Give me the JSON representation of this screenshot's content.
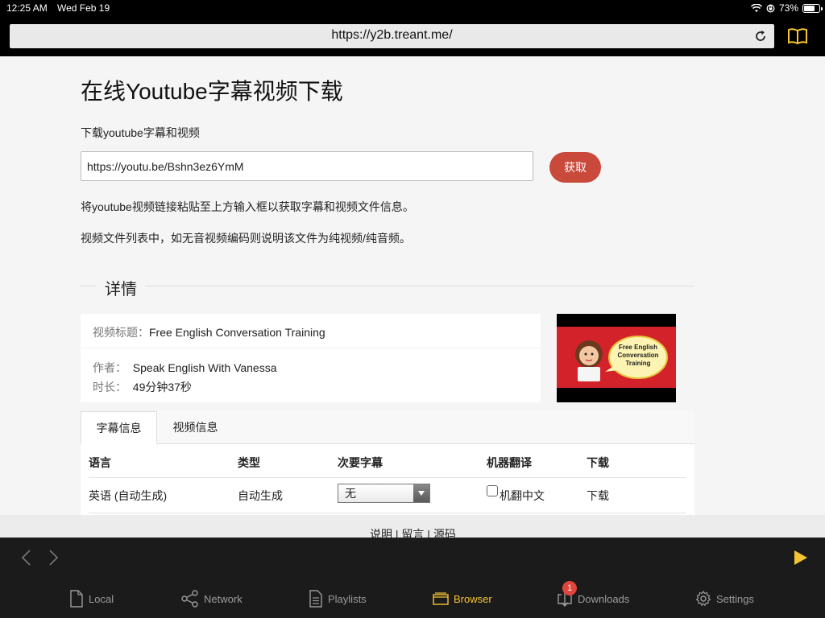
{
  "status": {
    "time": "12:25 AM",
    "date": "Wed Feb 19",
    "battery": "73%"
  },
  "browser": {
    "url": "https://y2b.treant.me/"
  },
  "page": {
    "title": "在线Youtube字幕视频下载",
    "subtitle": "下载youtube字幕和视频",
    "input_value": "https://youtu.be/Bshn3ez6YmM",
    "fetch_label": "获取",
    "tip1": "将youtube视频链接粘贴至上方输入框以获取字幕和视频文件信息。",
    "tip2": "视频文件列表中，如无音视频编码则说明该文件为纯视频/纯音频。",
    "section_title": "详情",
    "info": {
      "title_label": "视频标题：",
      "title_value": "Free English Conversation Training",
      "author_label": "作者：",
      "author_value": "Speak English With Vanessa",
      "duration_label": "时长：",
      "duration_value": "49分钟37秒"
    },
    "thumbnail_text": "Free English Conversation Training",
    "tabs": [
      "字幕信息",
      "视频信息"
    ],
    "table": {
      "headers": [
        "语言",
        "类型",
        "次要字幕",
        "机器翻译",
        "下载"
      ],
      "row": {
        "language": "英语 (自动生成)",
        "type": "自动生成",
        "secondary": "无",
        "translate": "机翻中文",
        "download": "下载"
      }
    },
    "footer": "说明 | 留言 | 源码"
  },
  "appbar": {
    "tabs": [
      {
        "label": "Local",
        "icon": "file-icon"
      },
      {
        "label": "Network",
        "icon": "share-network-icon"
      },
      {
        "label": "Playlists",
        "icon": "document-list-icon"
      },
      {
        "label": "Browser",
        "icon": "browser-window-icon"
      },
      {
        "label": "Downloads",
        "icon": "download-tray-icon"
      },
      {
        "label": "Settings",
        "icon": "gear-icon"
      }
    ],
    "downloads_badge": "1",
    "active_tab": "Browser",
    "accent_color": "#f5c431"
  }
}
